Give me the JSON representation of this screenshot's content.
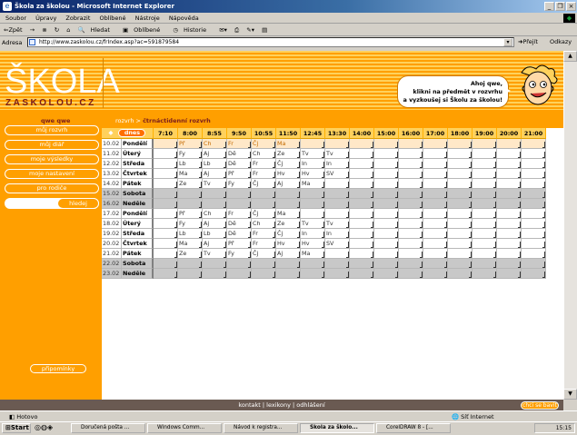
{
  "window": {
    "title": "Škola za školou - Microsoft Internet Explorer"
  },
  "menu": [
    "Soubor",
    "Úpravy",
    "Zobrazit",
    "Oblíbené",
    "Nástroje",
    "Nápověda"
  ],
  "toolbar": {
    "back": "⇐Zpět",
    "forward": "→",
    "search": "Hledat",
    "favorites": "Oblíbené",
    "history": "Historie"
  },
  "address": {
    "label": "Adresa",
    "url": "http://www.zaskolou.cz/frIndex.asp?ac=591879584",
    "go": "Přejít",
    "links": "Odkazy"
  },
  "logo": {
    "main": "ŠKOLA",
    "sub": "ZASKOLOU.CZ"
  },
  "bubble": {
    "line1": "Ahoj qwe,",
    "line2": "klikni na předmět v rozvrhu",
    "line3": "a vyzkoušej si Školu za školou!"
  },
  "user": "qwe qwe",
  "breadcrumb": {
    "link": "rozvrh",
    "sep": ">",
    "current": "čtrnáctidenní rozvrh"
  },
  "sidebar": [
    "můj rozvrh",
    "můj diář",
    "moje výsledky",
    "moje nastavení",
    "pro rodiče"
  ],
  "search": {
    "button": "hledej"
  },
  "reminders": "připomínky",
  "schedule": {
    "today_label": "dnes",
    "times": [
      "7:10",
      "8:00",
      "8:55",
      "9:50",
      "10:55",
      "11:50",
      "12:45",
      "13:30",
      "14:00",
      "15:00",
      "16:00",
      "17:00",
      "18:00",
      "19:00",
      "20:00",
      "21:00"
    ],
    "rows": [
      {
        "date": "10.02",
        "day": "Pondělí",
        "lessons": [
          "",
          "Př",
          "Ch",
          "Fr",
          "Čj",
          "Ma",
          "",
          "",
          "",
          "",
          "",
          "",
          "",
          "",
          "",
          ""
        ]
      },
      {
        "date": "11.02",
        "day": "Úterý",
        "lessons": [
          "",
          "Fy",
          "Aj",
          "Dě",
          "Ch",
          "Ze",
          "Tv",
          "Tv",
          "",
          "",
          "",
          "",
          "",
          "",
          "",
          ""
        ]
      },
      {
        "date": "12.02",
        "day": "Středa",
        "lessons": [
          "",
          "Lb",
          "Lb",
          "Dě",
          "Fr",
          "Čj",
          "In",
          "In",
          "",
          "",
          "",
          "",
          "",
          "",
          "",
          ""
        ]
      },
      {
        "date": "13.02",
        "day": "Čtvrtek",
        "lessons": [
          "",
          "Ma",
          "Aj",
          "Př",
          "Fr",
          "Hv",
          "Hv",
          "SV",
          "",
          "",
          "",
          "",
          "",
          "",
          "",
          ""
        ]
      },
      {
        "date": "14.02",
        "day": "Pátek",
        "lessons": [
          "",
          "Ze",
          "Tv",
          "Fy",
          "Čj",
          "Aj",
          "Ma",
          "",
          "",
          "",
          "",
          "",
          "",
          "",
          "",
          ""
        ]
      },
      {
        "date": "15.02",
        "day": "Sobota",
        "lessons": [
          "",
          "",
          "",
          "",
          "",
          "",
          "",
          "",
          "",
          "",
          "",
          "",
          "",
          "",
          "",
          ""
        ]
      },
      {
        "date": "16.02",
        "day": "Neděle",
        "lessons": [
          "",
          "",
          "",
          "",
          "",
          "",
          "",
          "",
          "",
          "",
          "",
          "",
          "",
          "",
          "",
          ""
        ]
      },
      {
        "date": "17.02",
        "day": "Pondělí",
        "lessons": [
          "",
          "Př",
          "Ch",
          "Fr",
          "Čj",
          "Ma",
          "",
          "",
          "",
          "",
          "",
          "",
          "",
          "",
          "",
          ""
        ]
      },
      {
        "date": "18.02",
        "day": "Úterý",
        "lessons": [
          "",
          "Fy",
          "Aj",
          "Dě",
          "Ch",
          "Ze",
          "Tv",
          "Tv",
          "",
          "",
          "",
          "",
          "",
          "",
          "",
          ""
        ]
      },
      {
        "date": "19.02",
        "day": "Středa",
        "lessons": [
          "",
          "Lb",
          "Lb",
          "Dě",
          "Fr",
          "Čj",
          "In",
          "In",
          "",
          "",
          "",
          "",
          "",
          "",
          "",
          ""
        ]
      },
      {
        "date": "20.02",
        "day": "Čtvrtek",
        "lessons": [
          "",
          "Ma",
          "Aj",
          "Př",
          "Fr",
          "Hv",
          "Hv",
          "SV",
          "",
          "",
          "",
          "",
          "",
          "",
          "",
          ""
        ]
      },
      {
        "date": "21.02",
        "day": "Pátek",
        "lessons": [
          "",
          "Ze",
          "Tv",
          "Fy",
          "Čj",
          "Aj",
          "Ma",
          "",
          "",
          "",
          "",
          "",
          "",
          "",
          "",
          ""
        ]
      },
      {
        "date": "22.02",
        "day": "Sobota",
        "lessons": [
          "",
          "",
          "",
          "",
          "",
          "",
          "",
          "",
          "",
          "",
          "",
          "",
          "",
          "",
          "",
          ""
        ]
      },
      {
        "date": "23.02",
        "day": "Neděle",
        "lessons": [
          "",
          "",
          "",
          "",
          "",
          "",
          "",
          "",
          "",
          "",
          "",
          "",
          "",
          "",
          "",
          ""
        ]
      }
    ]
  },
  "footer": {
    "text": "kontakt | lexikony | odhlášení",
    "button": "chci se bavit"
  },
  "status": {
    "text": "Hotovo",
    "zone": "Síť Internet"
  },
  "taskbar": {
    "start": "Start",
    "tasks": [
      "Doručená pošta ...",
      "Windows Comm...",
      "Návod k registra...",
      "Škola za školo...",
      "CorelDRAW 8 - [..."
    ],
    "clock": "15:15"
  }
}
